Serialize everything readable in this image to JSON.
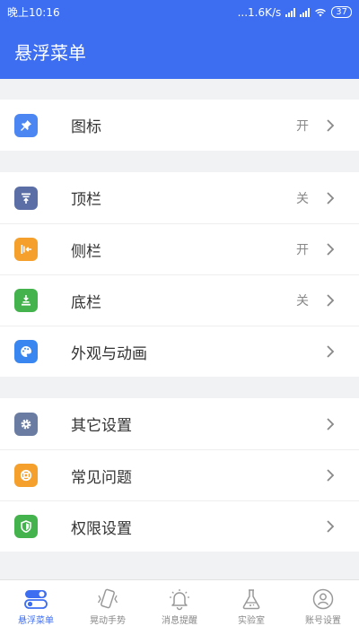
{
  "status_bar": {
    "time": "晚上10:16",
    "speed": "...1.6K/s",
    "battery": "37"
  },
  "title": "悬浮菜单",
  "groups": [
    [
      {
        "label": "图标",
        "state": "开",
        "icon": "pin-icon",
        "color": "#4b86f2"
      }
    ],
    [
      {
        "label": "顶栏",
        "state": "关",
        "icon": "top-bar-icon",
        "color": "#5b6fa6"
      },
      {
        "label": "侧栏",
        "state": "开",
        "icon": "side-bar-icon",
        "color": "#f5a02c"
      },
      {
        "label": "底栏",
        "state": "关",
        "icon": "bottom-bar-icon",
        "color": "#45b34d"
      },
      {
        "label": "外观与动画",
        "state": "",
        "icon": "palette-icon",
        "color": "#3a86f0"
      }
    ],
    [
      {
        "label": "其它设置",
        "state": "",
        "icon": "gear-icon",
        "color": "#6b7ca3"
      },
      {
        "label": "常见问题",
        "state": "",
        "icon": "lifebuoy-icon",
        "color": "#f5a02c"
      },
      {
        "label": "权限设置",
        "state": "",
        "icon": "shield-icon",
        "color": "#45b34d"
      }
    ]
  ],
  "tabs": [
    {
      "label": "悬浮菜单",
      "icon": "toggle-icon",
      "active": true
    },
    {
      "label": "晃动手势",
      "icon": "shake-phone-icon",
      "active": false
    },
    {
      "label": "消息提醒",
      "icon": "bell-icon",
      "active": false
    },
    {
      "label": "实验室",
      "icon": "flask-icon",
      "active": false
    },
    {
      "label": "账号设置",
      "icon": "account-icon",
      "active": false
    }
  ],
  "colors": {
    "primary": "#3d6ef2",
    "background": "#f1f2f4"
  }
}
